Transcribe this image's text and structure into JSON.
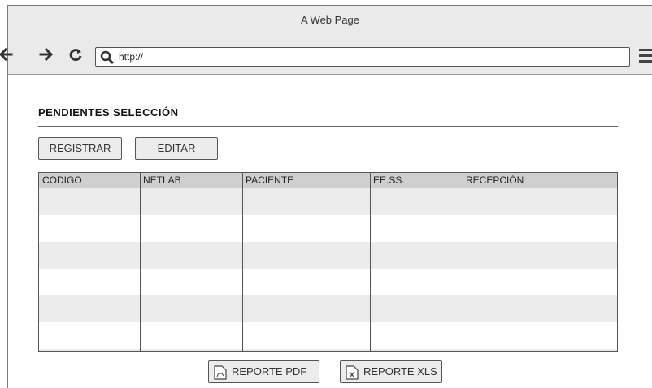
{
  "window": {
    "title": "A Web Page"
  },
  "navigation": {
    "back_icon": "back-arrow-icon",
    "forward_icon": "forward-arrow-icon",
    "reload_icon": "reload-icon",
    "search_icon": "search-icon",
    "url": "http://",
    "menu_icon": "hamburger-menu-icon"
  },
  "page": {
    "title": "PENDIENTES SELECCIÓN",
    "buttons": {
      "register": "REGISTRAR",
      "edit": "EDITAR"
    },
    "table": {
      "columns": [
        "CODIGO",
        "NETLAB",
        "PACIENTE",
        "EE.SS.",
        "RECEPCIÓN"
      ],
      "rows": []
    },
    "reports": {
      "pdf": "REPORTE PDF",
      "xls": "REPORTE XLS"
    }
  }
}
